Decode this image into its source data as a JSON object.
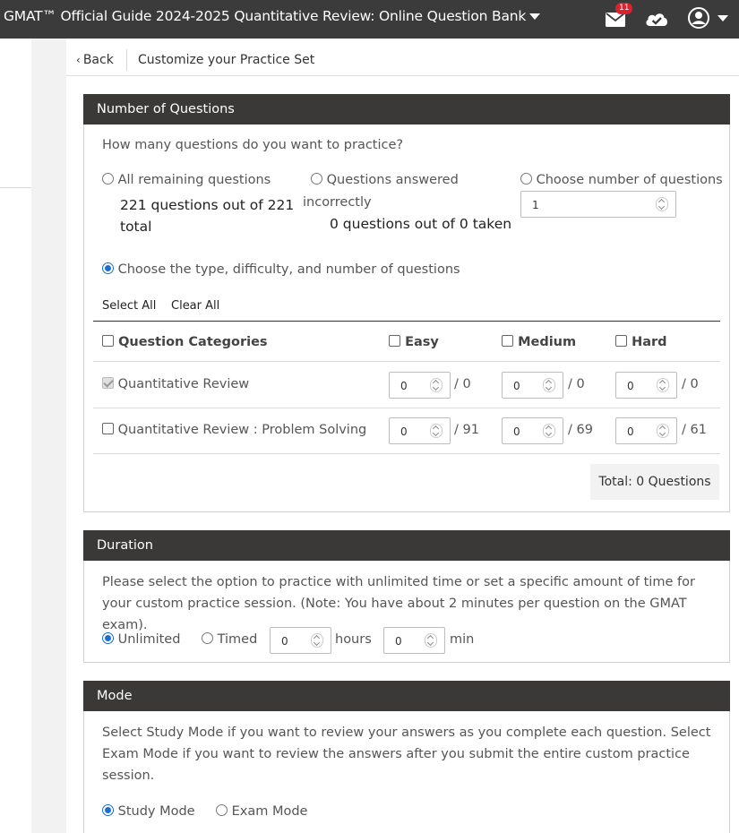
{
  "header": {
    "title": "GMAT™ Official Guide 2024-2025 Quantitative Review: Online Question Bank",
    "mail_badge": "11",
    "icons": [
      "mail-icon",
      "cloud-check-icon",
      "user-icon",
      "chevron-down-icon"
    ]
  },
  "breadcrumb": {
    "back_label": "Back",
    "title": "Customize your Practice Set"
  },
  "questions_panel": {
    "heading": "Number of Questions",
    "prompt": "How many questions do you want to practice?",
    "option_all": {
      "label": "All remaining questions",
      "detail_line1": "221 questions out of 221",
      "detail_line2": "total"
    },
    "option_incorrect": {
      "label": "Questions answered",
      "label_line2": "incorrectly",
      "detail": "0 questions out of 0 taken"
    },
    "option_number": {
      "label": "Choose number of questions",
      "value": "1"
    },
    "option_type": {
      "label": "Choose the type, difficulty, and number of questions"
    },
    "select_all": "Select All",
    "clear_all": "Clear All",
    "table": {
      "headers": [
        "Question Categories",
        "Easy",
        "Medium",
        "Hard"
      ],
      "rows": [
        {
          "name": "Quantitative Review",
          "easy": "0",
          "easy_max": "/ 0",
          "medium": "0",
          "medium_max": "/ 0",
          "hard": "0",
          "hard_max": "/ 0"
        },
        {
          "name": "Quantitative Review : Problem Solving",
          "easy": "0",
          "easy_max": "/ 91",
          "medium": "0",
          "medium_max": "/ 69",
          "hard": "0",
          "hard_max": "/ 61"
        }
      ]
    },
    "total": "Total: 0 Questions"
  },
  "duration_panel": {
    "heading": "Duration",
    "description": "Please select the option to practice with unlimited time or set a specific amount of time for your custom practice session. (Note: You have about 2 minutes per question on the GMAT exam).",
    "unlimited": "Unlimited",
    "timed": "Timed",
    "hours_value": "0",
    "hours_label": "hours",
    "min_value": "0",
    "min_label": "min"
  },
  "mode_panel": {
    "heading": "Mode",
    "description": "Select Study Mode if you want to review your answers as you complete each question. Select Exam Mode if you want to review the answers after you submit the entire custom practice session.",
    "study": "Study Mode",
    "exam": "Exam Mode"
  }
}
